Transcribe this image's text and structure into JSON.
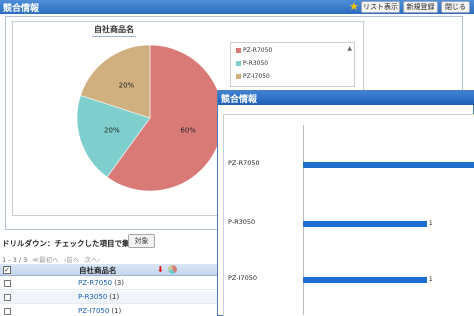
{
  "window": {
    "title": "競合情報"
  },
  "toolbar": {
    "list_label": "リスト表示",
    "new_label": "新規登録",
    "close_label": "閉じる"
  },
  "chart": {
    "title": "自社商品名",
    "legend": [
      {
        "label": "PZ-R7050",
        "color": "#d97a77"
      },
      {
        "label": "P-R3050",
        "color": "#7fcfcf"
      },
      {
        "label": "PZ-I7050",
        "color": "#cfb07e"
      }
    ]
  },
  "chart_data": [
    {
      "type": "pie",
      "title": "自社商品名",
      "labels": [
        "PZ-R7050",
        "P-R3050",
        "PZ-I7050"
      ],
      "values": [
        60,
        20,
        20
      ],
      "data_labels": [
        "60%",
        "20%",
        "20%"
      ],
      "colors": [
        "#d97a77",
        "#7fcfcf",
        "#cfb07e"
      ]
    },
    {
      "type": "bar",
      "orientation": "horizontal",
      "categories": [
        "PZ-R7050",
        "P-R3050",
        "PZ-I7050"
      ],
      "values": [
        3,
        1,
        1
      ],
      "data_labels": [
        "",
        "1",
        "1"
      ]
    }
  ],
  "drilldown": {
    "label": "ドリルダウン：チェックした項目で集計",
    "button_label": "対象"
  },
  "pager": {
    "range": "1 - 3 / 3",
    "first": "≪最初へ",
    "prev": "‹前へ",
    "next": "次へ›"
  },
  "table": {
    "header_check": "✓",
    "column": "自社商品名",
    "rows": [
      {
        "name": "PZ-R7050",
        "count": "(3)"
      },
      {
        "name": "P-R3050",
        "count": "(1)"
      },
      {
        "name": "PZ-I7050",
        "count": "(1)"
      }
    ]
  },
  "popup": {
    "title": "競合情報"
  }
}
